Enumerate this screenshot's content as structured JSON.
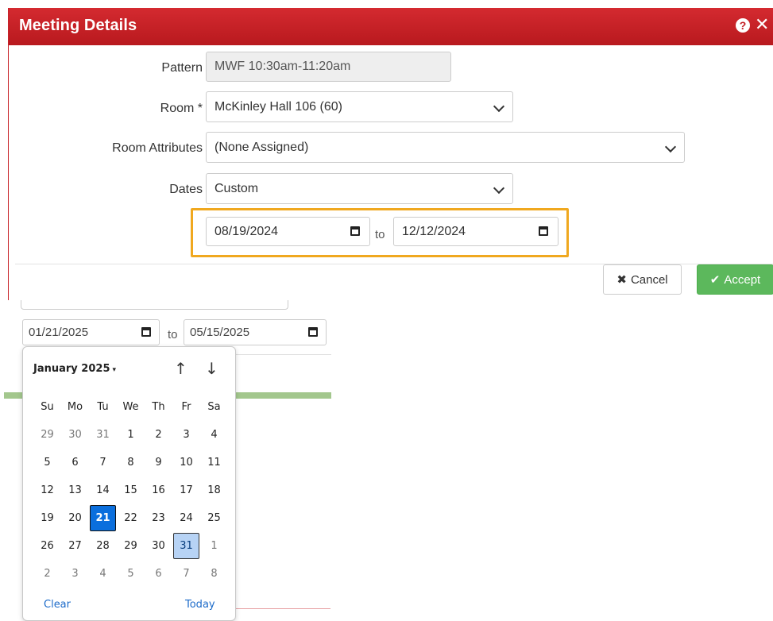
{
  "modal": {
    "title": "Meeting Details",
    "help_icon": "?",
    "close_icon": "✕",
    "accent_color": "#c41f25",
    "pattern": {
      "label": "Pattern",
      "value": "MWF 10:30am-11:20am"
    },
    "room": {
      "label": "Room *",
      "value": "McKinley Hall 106 (60)"
    },
    "room_attributes": {
      "label": "Room Attributes",
      "value": "(None Assigned)"
    },
    "dates": {
      "label": "Dates",
      "value": "Custom"
    },
    "date_range": {
      "start": "08/19/2024",
      "to": "to",
      "end": "12/12/2024"
    },
    "buttons": {
      "cancel": "Cancel",
      "cancel_icon": "✖",
      "accept": "Accept",
      "accept_icon": "✔"
    }
  },
  "background_dates": {
    "start": "01/21/2025",
    "to": "to",
    "end": "05/15/2025"
  },
  "calendar": {
    "month_label": "January 2025",
    "caret": "▾",
    "prev_arrow": "↑",
    "next_arrow": "↓",
    "weekdays": [
      "Su",
      "Mo",
      "Tu",
      "We",
      "Th",
      "Fr",
      "Sa"
    ],
    "weeks": [
      [
        "29",
        "30",
        "31",
        "1",
        "2",
        "3",
        "4"
      ],
      [
        "5",
        "6",
        "7",
        "8",
        "9",
        "10",
        "11"
      ],
      [
        "12",
        "13",
        "14",
        "15",
        "16",
        "17",
        "18"
      ],
      [
        "19",
        "20",
        "21",
        "22",
        "23",
        "24",
        "25"
      ],
      [
        "26",
        "27",
        "28",
        "29",
        "30",
        "31",
        "1"
      ],
      [
        "2",
        "3",
        "4",
        "5",
        "6",
        "7",
        "8"
      ]
    ],
    "selected_day": "21",
    "highlighted_day": "31",
    "clear": "Clear",
    "today": "Today",
    "selected_color": "#0b6fdd"
  }
}
